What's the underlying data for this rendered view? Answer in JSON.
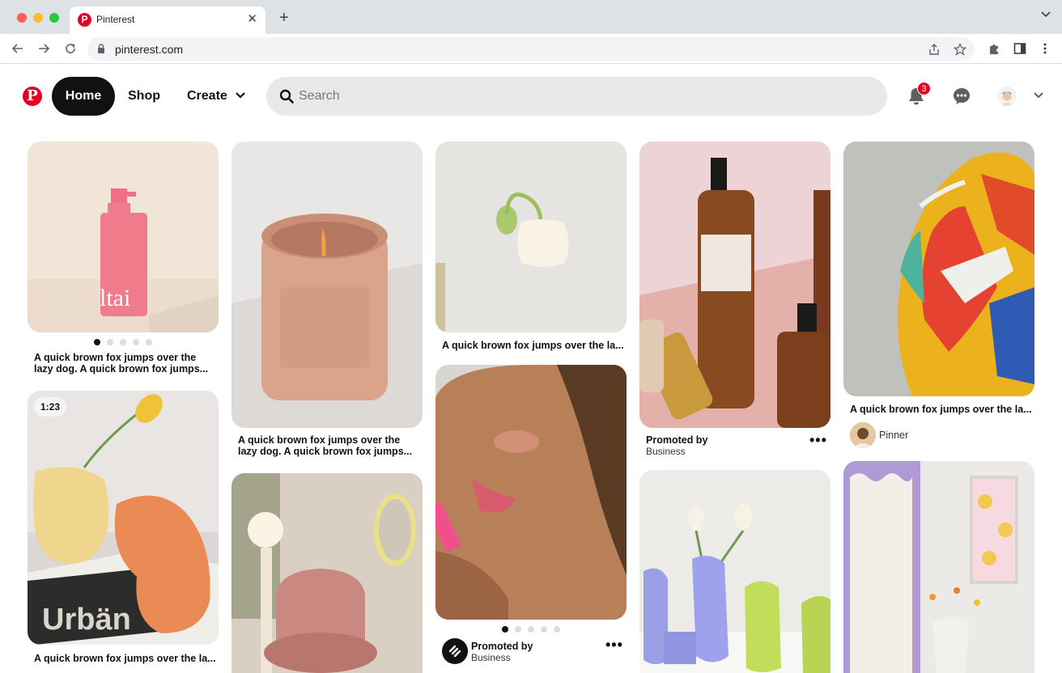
{
  "browser": {
    "tab_title": "Pinterest",
    "tab_favicon": "P",
    "url": "pinterest.com",
    "close_glyph": "✕",
    "new_tab_glyph": "+"
  },
  "header": {
    "logo_glyph": "P",
    "nav": {
      "home": "Home",
      "shop": "Shop",
      "create": "Create"
    },
    "search_placeholder": "Search",
    "notification_count": "3"
  },
  "pins": {
    "serum": {
      "caption_line1": "A quick brown fox jumps over the",
      "caption_line2": "lazy dog. A quick brown fox jumps...",
      "slides": 5,
      "active_slide": 0
    },
    "vases_video": {
      "duration": "1:23",
      "caption": "A quick brown fox jumps over the la..."
    },
    "candle": {
      "caption_line1": "A quick brown fox jumps over the",
      "caption_line2": "lazy dog. A quick brown fox jumps..."
    },
    "lamp": {
      "caption": "A quick brown fox jumps over the la..."
    },
    "portrait": {
      "promoted_by": "Promoted by",
      "business": "Business",
      "slides": 5,
      "active_slide": 0
    },
    "aesop": {
      "promoted_by": "Promoted by",
      "business": "Business"
    },
    "sneaker": {
      "caption": "A quick brown fox jumps over the la...",
      "pinner": "Pinner"
    }
  },
  "colors": {
    "brand": "#e60023",
    "home_pill": "#111111",
    "search_bg": "#e9e9e9"
  }
}
